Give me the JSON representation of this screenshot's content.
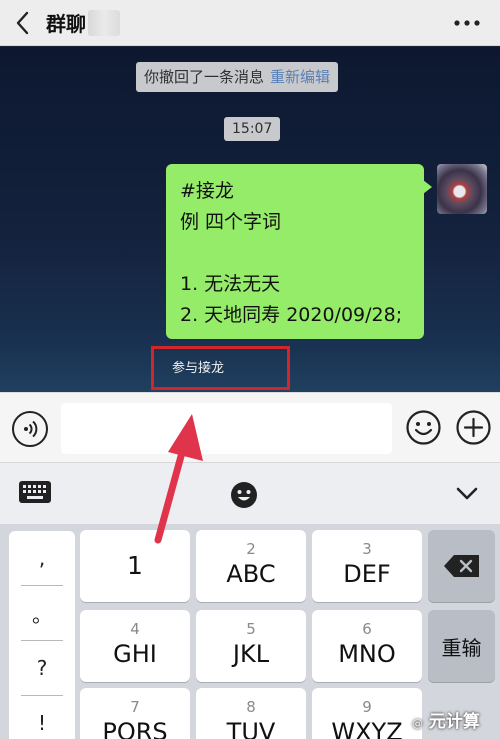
{
  "header": {
    "title": "群聊",
    "back_icon": "chevron-left-icon",
    "more_icon": "more-dots-icon"
  },
  "chat": {
    "recall_notice": "你撤回了一条消息",
    "reedit_link": "重新编辑",
    "timestamp": "15:07",
    "message_lines": [
      "#接龙",
      "例 四个字词",
      "",
      "1. 无法无天",
      "2. 天地同寿 2020/09/28;"
    ],
    "join_label": "参与接龙"
  },
  "input_bar": {
    "voice_icon": "voice-icon",
    "input_value": "",
    "emoji_icon": "smile-icon",
    "plus_icon": "plus-circle-icon"
  },
  "keyboard_toolbar": {
    "switch_icon": "keyboard-icon",
    "emoji_icon": "emoji-icon",
    "collapse_icon": "chevron-down-icon"
  },
  "keyboard": {
    "punctuation": [
      ",",
      "。",
      "?",
      "!"
    ],
    "keys": [
      {
        "num": "",
        "letters": "1"
      },
      {
        "num": "2",
        "letters": "ABC"
      },
      {
        "num": "3",
        "letters": "DEF"
      },
      {
        "num": "4",
        "letters": "GHI"
      },
      {
        "num": "5",
        "letters": "JKL"
      },
      {
        "num": "6",
        "letters": "MNO"
      },
      {
        "num": "7",
        "letters": "PQRS"
      },
      {
        "num": "8",
        "letters": "TUV"
      },
      {
        "num": "9",
        "letters": "WXYZ"
      }
    ],
    "delete_icon": "backspace-icon",
    "reenter_label": "重输"
  },
  "watermark": {
    "prefix": "@",
    "text": "元计算"
  },
  "colors": {
    "bubble": "#95ec69",
    "highlight": "#d3262b",
    "link": "#5a7fb5"
  }
}
